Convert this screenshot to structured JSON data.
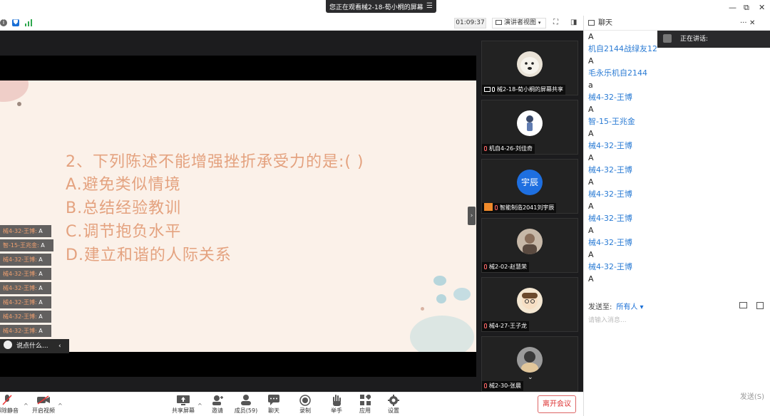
{
  "window": {
    "share_banner": "您正在观看械2-18-荀小桐的屏幕",
    "controls": [
      "—",
      "⧉",
      "✕"
    ]
  },
  "meeting_bar": {
    "timer": "01:09:37",
    "view_mode": "演讲者视图"
  },
  "slide": {
    "question": "2、下列陈述不能增强挫折承受力的是:( )",
    "options": [
      "A.避免类似情境",
      "B.总结经验教训",
      "C.调节抱负水平",
      "D.建立和谐的人际关系"
    ]
  },
  "overlay_chat": [
    {
      "name": "械4-32-王博:",
      "text": "A"
    },
    {
      "name": "智-15-王兆金:",
      "text": "A"
    },
    {
      "name": "械4-32-王博:",
      "text": "A"
    },
    {
      "name": "械4-32-王博:",
      "text": "A"
    },
    {
      "name": "械4-32-王博:",
      "text": "A"
    },
    {
      "name": "械4-32-王博:",
      "text": "A"
    },
    {
      "name": "械4-32-王博:",
      "text": "A"
    },
    {
      "name": "械4-32-王博:",
      "text": "A"
    }
  ],
  "overlay_input": "说点什么...",
  "gallery": [
    {
      "name": "械2-18-荀小桐的屏幕共享",
      "avatar": "dog-photo"
    },
    {
      "name": "机自4-26-刘佳奇",
      "avatar": "cartoon-person"
    },
    {
      "name": "智能制造2041刘宇辰",
      "avatar": "text-avatar",
      "avatar_text": "宇辰",
      "avatar_color": "#1e6fe0"
    },
    {
      "name": "械2-02-赵慧荣",
      "avatar": "photo"
    },
    {
      "name": "械4-27-王子龙",
      "avatar": "cartoon-face"
    },
    {
      "name": "械2-30-张晨",
      "avatar": "photo"
    }
  ],
  "chat": {
    "title": "聊天",
    "speaking_label": "正在讲话:",
    "messages": [
      {
        "sender": "",
        "text": "A"
      },
      {
        "sender": "机自2144战绿友12",
        "text": "A"
      },
      {
        "sender": "毛永乐机自2144",
        "text": "a"
      },
      {
        "sender": "械4-32-王博",
        "text": "A"
      },
      {
        "sender": "智-15-王兆金",
        "text": "A"
      },
      {
        "sender": "械4-32-王博",
        "text": "A"
      },
      {
        "sender": "械4-32-王博",
        "text": "A"
      },
      {
        "sender": "械4-32-王博",
        "text": "A"
      },
      {
        "sender": "械4-32-王博",
        "text": "A"
      },
      {
        "sender": "械4-32-王博",
        "text": "A"
      },
      {
        "sender": "械4-32-王博",
        "text": "A"
      }
    ],
    "send_to_label": "发送至:",
    "send_to_value": "所有人",
    "input_placeholder": "请输入消息...",
    "send_label": "发送(S)"
  },
  "toolbar": {
    "unmute": "解除静音",
    "start_video": "开启视频",
    "share_screen": "共享屏幕",
    "invite": "邀请",
    "participants": "成员(59)",
    "chat": "聊天",
    "record": "录制",
    "raise_hand": "举手",
    "apps": "应用",
    "settings": "设置",
    "leave": "离开会议"
  },
  "colors": {
    "accent": "#1a6fd6",
    "slide_bg": "#fbf1e9",
    "slide_text": "#e4a27f",
    "leave_red": "#d33"
  }
}
